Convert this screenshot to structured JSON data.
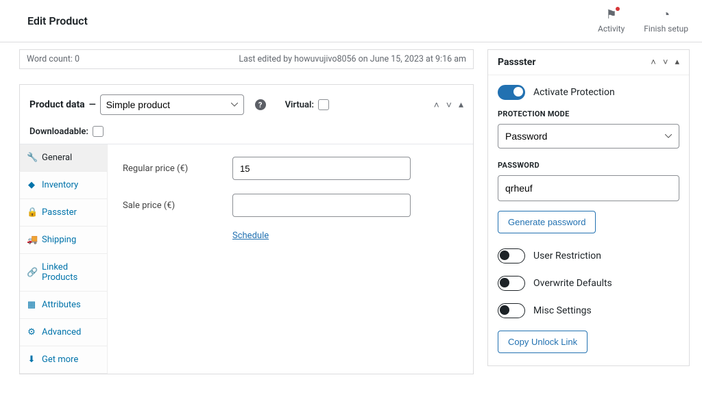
{
  "header": {
    "title": "Edit Product",
    "activity": "Activity",
    "finish_setup": "Finish setup"
  },
  "editor_meta": {
    "word_count_label": "Word count: 0",
    "last_edited": "Last edited by howuvujivo8056 on June 15, 2023 at 9:16 am"
  },
  "product_data": {
    "title": "Product data",
    "dash": "—",
    "type_value": "Simple product",
    "virtual_label": "Virtual:",
    "downloadable_label": "Downloadable:",
    "tabs": {
      "general": "General",
      "inventory": "Inventory",
      "passster": "Passster",
      "shipping": "Shipping",
      "linked": "Linked Products",
      "attributes": "Attributes",
      "advanced": "Advanced",
      "getmore": "Get more"
    },
    "panel": {
      "regular_price_label": "Regular price (€)",
      "regular_price_value": "15",
      "sale_price_label": "Sale price (€)",
      "sale_price_value": "",
      "schedule": "Schedule"
    }
  },
  "passster": {
    "box_title": "Passster",
    "activate_label": "Activate Protection",
    "mode_label": "PROTECTION MODE",
    "mode_value": "Password",
    "password_label": "PASSWORD",
    "password_value": "qrheuf",
    "generate_btn": "Generate password",
    "user_restriction": "User Restriction",
    "overwrite_defaults": "Overwrite Defaults",
    "misc_settings": "Misc Settings",
    "copy_link": "Copy Unlock Link"
  }
}
